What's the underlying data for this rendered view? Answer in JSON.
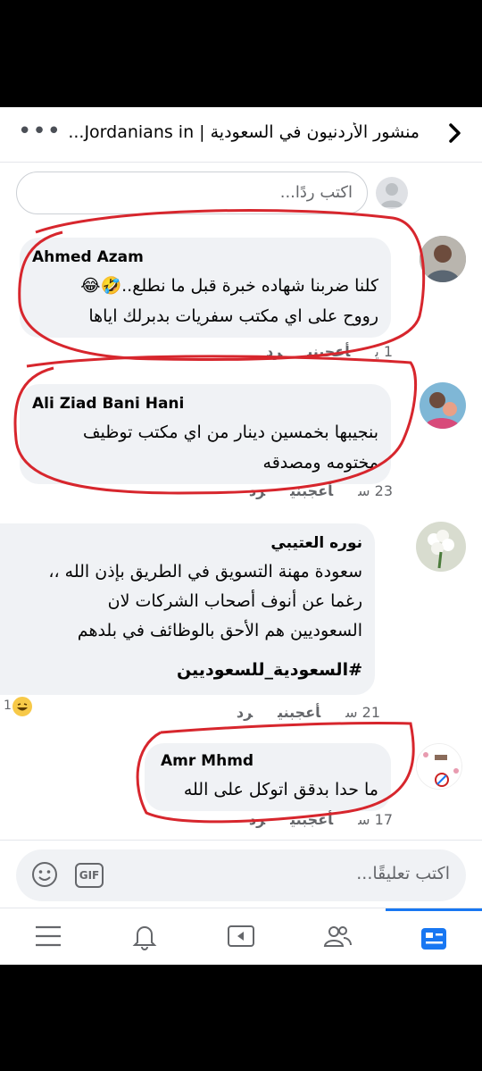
{
  "header": {
    "title": "منشور الأردنيون في السعودية | Jordanians in...",
    "back_icon": "chevron-left-icon",
    "more_icon": "more-dots-icon"
  },
  "reply": {
    "placeholder": "اكتب ردًا..."
  },
  "comments": [
    {
      "name": "Ahmed Azam",
      "lines": [
        "كلنا ضربنا شهاده خبرة قبل ما نطلع..🤣😂",
        "رووح على اي مكتب سفريات بدبرلك اياها"
      ],
      "time": "1 ي",
      "like": "أعجبني",
      "reply": "رد"
    },
    {
      "name": "Ali Ziad Bani Hani",
      "lines": [
        "بنجيبها بخمسين دينار من اي مكتب توظيف",
        "مختومه ومصدقه"
      ],
      "time": "23 س",
      "like": "أعجبني",
      "reply": "رد"
    },
    {
      "name": "نوره العتيبي",
      "lines": [
        "سعودة مهنة التسويق في الطريق بإذن الله ،،",
        "رغما عن أنوف أصحاب الشركات لان",
        "السعوديين هم الأحق بالوظائف في بلدهم",
        "",
        "#السعودية_للسعوديين"
      ],
      "time": "21 س",
      "like": "أعجبني",
      "reply": "رد",
      "reaction_count": "1"
    },
    {
      "name": "Amr Mhmd",
      "lines": [
        "ما حدا بدقق اتوكل على الله"
      ],
      "time": "17 س",
      "like": "أعجبني",
      "reply": "رد"
    }
  ],
  "compose": {
    "placeholder": "اكتب تعليقًا...",
    "gif_label": "GIF",
    "emoji_icon": "smiley-icon"
  },
  "tabs": [
    "menu-icon",
    "bell-icon",
    "video-icon",
    "friends-icon",
    "news-feed-icon"
  ],
  "colors": {
    "accent": "#1877f2",
    "annotation": "#d7262d",
    "bubble": "#f0f2f5"
  }
}
